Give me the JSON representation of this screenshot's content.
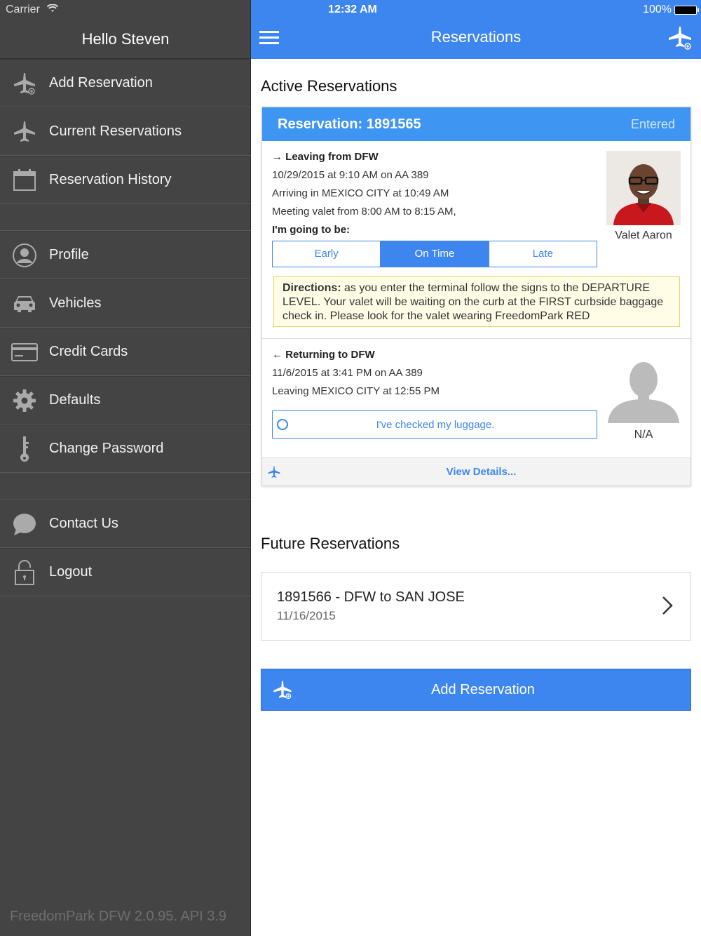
{
  "status": {
    "carrier": "Carrier",
    "time": "12:32 AM",
    "battery": "100%"
  },
  "sidebar": {
    "greeting": "Hello Steven",
    "items": [
      {
        "label": "Add Reservation",
        "icon": "plane-add-icon"
      },
      {
        "label": "Current Reservations",
        "icon": "plane-icon"
      },
      {
        "label": "Reservation History",
        "icon": "calendar-icon"
      },
      {
        "label": "Profile",
        "icon": "user-icon"
      },
      {
        "label": "Vehicles",
        "icon": "car-icon"
      },
      {
        "label": "Credit Cards",
        "icon": "credit-card-icon"
      },
      {
        "label": "Defaults",
        "icon": "gear-icon"
      },
      {
        "label": "Change Password",
        "icon": "key-icon"
      },
      {
        "label": "Contact Us",
        "icon": "chat-icon"
      },
      {
        "label": "Logout",
        "icon": "lock-icon"
      }
    ],
    "footer": "FreedomPark DFW 2.0.95. API 3.9"
  },
  "header": {
    "title": "Reservations"
  },
  "active": {
    "section_title": "Active Reservations",
    "reservation_label": "Reservation: 1891565",
    "status": "Entered",
    "outbound": {
      "heading": "→ Leaving from DFW",
      "flight": "10/29/2015 at 9:10 AM on AA 389",
      "arrival": "Arriving in MEXICO CITY at 10:49 AM",
      "meeting": "Meeting valet from 8:00 AM to 8:15 AM,",
      "going_label": "I'm going to be:",
      "options": [
        "Early",
        "On Time",
        "Late"
      ],
      "selected": "On Time",
      "valet": "Valet Aaron",
      "directions_label": "Directions:",
      "directions_text": " as you enter the terminal follow the signs to the DEPARTURE LEVEL. Your valet will be waiting on the curb at the FIRST curbside baggage check in. Please look for the valet wearing FreedomPark RED"
    },
    "return": {
      "heading": "← Returning to DFW",
      "flight": "11/6/2015 at 3:41 PM on AA 389",
      "departure": "Leaving MEXICO CITY at 12:55 PM",
      "luggage": "I've checked my luggage.",
      "valet": "N/A"
    },
    "details_link": "View Details..."
  },
  "future": {
    "section_title": "Future Reservations",
    "items": [
      {
        "title": "1891566 - DFW to SAN JOSE",
        "date": "11/16/2015"
      }
    ]
  },
  "add_button": "Add Reservation",
  "colors": {
    "accent": "#3e86ef",
    "sidebar": "#444444",
    "card_header": "#3e96f2"
  }
}
